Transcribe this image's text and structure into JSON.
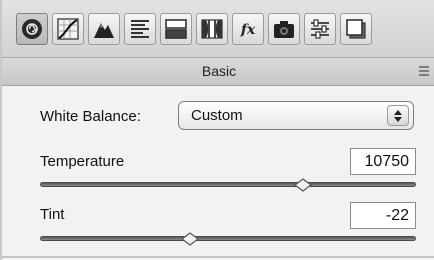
{
  "toolbar": {
    "tools": [
      {
        "icon": "basic-aperture-icon",
        "active": true
      },
      {
        "icon": "tone-curve-icon",
        "active": false
      },
      {
        "icon": "detail-icon",
        "active": false
      },
      {
        "icon": "hsl-grayscale-icon",
        "active": false
      },
      {
        "icon": "split-toning-icon",
        "active": false
      },
      {
        "icon": "lens-corrections-icon",
        "active": false
      },
      {
        "icon": "effects-fx-icon",
        "active": false
      },
      {
        "icon": "camera-calibration-icon",
        "active": false
      },
      {
        "icon": "presets-sliders-icon",
        "active": false
      },
      {
        "icon": "snapshots-icon",
        "active": false
      }
    ],
    "fx_label": "fx"
  },
  "section": {
    "title": "Basic",
    "menu_icon": "panel-menu-icon"
  },
  "white_balance": {
    "label": "White Balance:",
    "value": "Custom"
  },
  "temperature": {
    "label": "Temperature",
    "value": "10750",
    "slider_position": 0.7
  },
  "tint": {
    "label": "Tint",
    "value": "-22",
    "slider_position": 0.4
  }
}
